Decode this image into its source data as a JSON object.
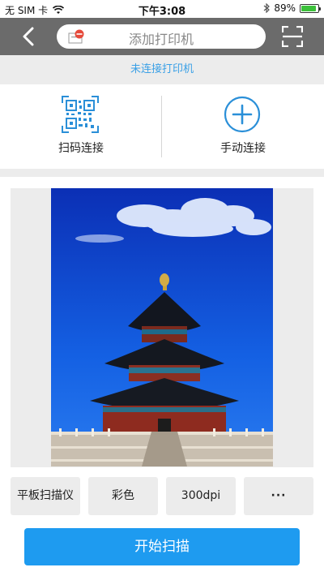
{
  "status_bar": {
    "carrier": "无 SIM 卡",
    "time": "下午3:08",
    "battery_percent": "89%",
    "battery_level": 0.89,
    "wifi_icon": "wifi-icon",
    "bluetooth_icon": "bluetooth-icon"
  },
  "nav": {
    "search_text": "添加打印机",
    "back_icon": "chevron-left-icon",
    "scan_icon": "scan-frame-icon"
  },
  "connection": {
    "status_text": "未连接打印机"
  },
  "connect_options": {
    "qr_label": "扫码连接",
    "manual_label": "手动连接"
  },
  "options": {
    "source": "平板扫描仪",
    "color_mode": "彩色",
    "resolution": "300dpi",
    "more": "···"
  },
  "start_button": "开始扫描",
  "colors": {
    "accent": "#1e9bf0",
    "link": "#3aa0e6",
    "nav_bg": "#6b6b6b"
  }
}
